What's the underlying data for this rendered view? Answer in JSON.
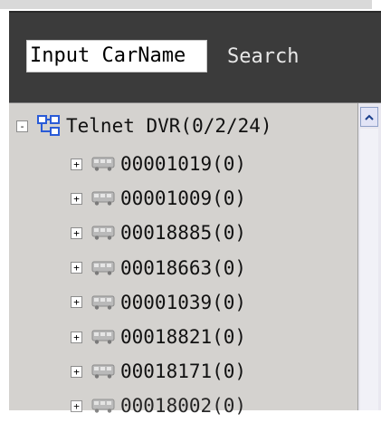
{
  "search": {
    "input_value": "Input CarName",
    "button_label": "Search"
  },
  "tree": {
    "root": {
      "label": "Telnet DVR(0/2/24)",
      "expander": "-",
      "icon": "network-group-icon"
    },
    "items": [
      {
        "label": "00001019(0)",
        "expander": "+",
        "icon": "bus-icon"
      },
      {
        "label": "00001009(0)",
        "expander": "+",
        "icon": "bus-icon"
      },
      {
        "label": "00018885(0)",
        "expander": "+",
        "icon": "bus-icon"
      },
      {
        "label": "00018663(0)",
        "expander": "+",
        "icon": "bus-icon"
      },
      {
        "label": "00001039(0)",
        "expander": "+",
        "icon": "bus-icon"
      },
      {
        "label": "00018821(0)",
        "expander": "+",
        "icon": "bus-icon"
      },
      {
        "label": "00018171(0)",
        "expander": "+",
        "icon": "bus-icon"
      },
      {
        "label": "00018002(0)",
        "expander": "+",
        "icon": "bus-icon"
      }
    ]
  },
  "colors": {
    "toolbar_bg": "#3b3b3b",
    "tree_bg": "#d4d2cf",
    "root_icon_blue": "#2a5bd7"
  }
}
